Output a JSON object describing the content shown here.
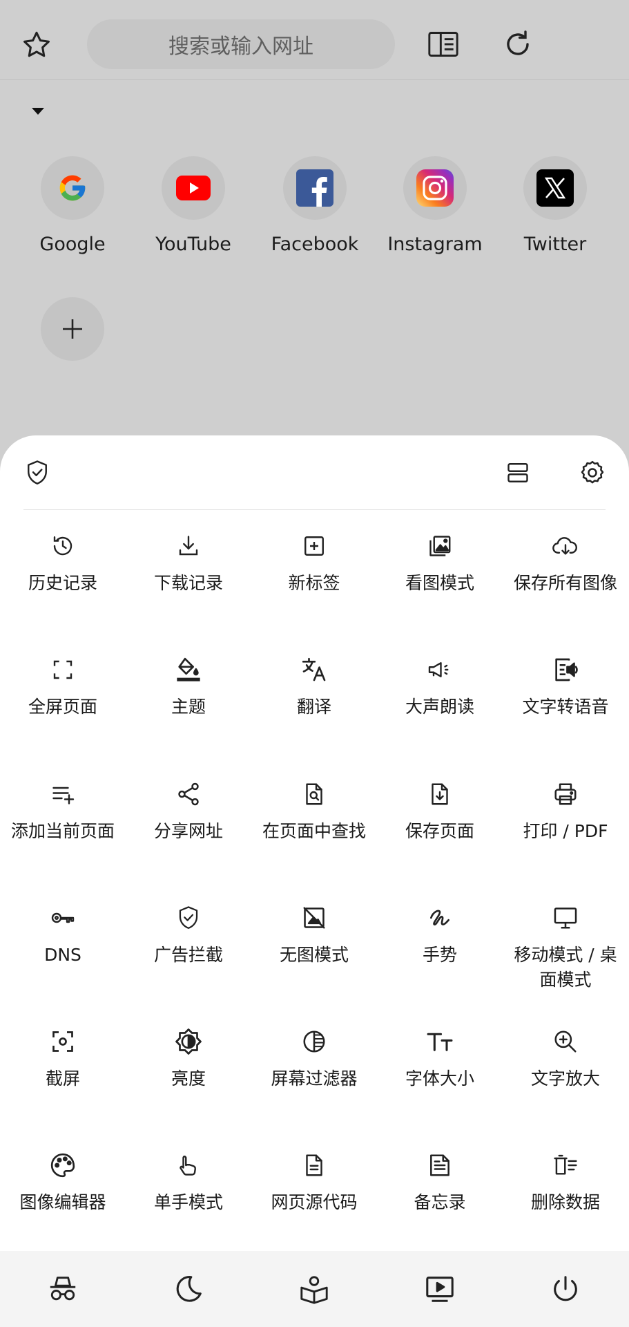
{
  "search": {
    "placeholder": "搜索或输入网址"
  },
  "speed_dial": [
    {
      "label": "Google",
      "icon": "google-icon"
    },
    {
      "label": "YouTube",
      "icon": "youtube-icon"
    },
    {
      "label": "Facebook",
      "icon": "facebook-icon"
    },
    {
      "label": "Instagram",
      "icon": "instagram-icon"
    },
    {
      "label": "Twitter",
      "icon": "x-twitter-icon"
    }
  ],
  "menu": [
    {
      "label": "历史记录",
      "icon": "history-icon"
    },
    {
      "label": "下载记录",
      "icon": "download-icon"
    },
    {
      "label": "新标签",
      "icon": "new-tab-icon"
    },
    {
      "label": "看图模式",
      "icon": "gallery-icon"
    },
    {
      "label": "保存所有图像",
      "icon": "cloud-download-icon"
    },
    {
      "label": "全屏页面",
      "icon": "fullscreen-icon"
    },
    {
      "label": "主题",
      "icon": "paint-bucket-icon"
    },
    {
      "label": "翻译",
      "icon": "translate-icon"
    },
    {
      "label": "大声朗读",
      "icon": "megaphone-icon"
    },
    {
      "label": "文字转语音",
      "icon": "text-to-speech-icon"
    },
    {
      "label": "添加当前页面",
      "icon": "playlist-add-icon"
    },
    {
      "label": "分享网址",
      "icon": "share-icon"
    },
    {
      "label": "在页面中查找",
      "icon": "find-in-page-icon"
    },
    {
      "label": "保存页面",
      "icon": "save-page-icon"
    },
    {
      "label": "打印 / PDF",
      "icon": "print-icon"
    },
    {
      "label": "DNS",
      "icon": "key-icon"
    },
    {
      "label": "广告拦截",
      "icon": "shield-check-icon"
    },
    {
      "label": "无图模式",
      "icon": "no-image-icon"
    },
    {
      "label": "手势",
      "icon": "gesture-icon"
    },
    {
      "label": "移动模式 / 桌面模式",
      "icon": "desktop-icon"
    },
    {
      "label": "截屏",
      "icon": "screenshot-icon"
    },
    {
      "label": "亮度",
      "icon": "brightness-icon"
    },
    {
      "label": "屏幕过滤器",
      "icon": "screen-filter-icon"
    },
    {
      "label": "字体大小",
      "icon": "font-size-icon"
    },
    {
      "label": "文字放大",
      "icon": "zoom-in-icon"
    },
    {
      "label": "图像编辑器",
      "icon": "palette-icon"
    },
    {
      "label": "单手模式",
      "icon": "one-hand-icon"
    },
    {
      "label": "网页源代码",
      "icon": "source-code-icon"
    },
    {
      "label": "备忘录",
      "icon": "memo-icon"
    },
    {
      "label": "删除数据",
      "icon": "delete-data-icon"
    }
  ],
  "bottom_bar": [
    "incognito-icon",
    "night-mode-icon",
    "reading-icon",
    "video-icon",
    "power-icon"
  ]
}
